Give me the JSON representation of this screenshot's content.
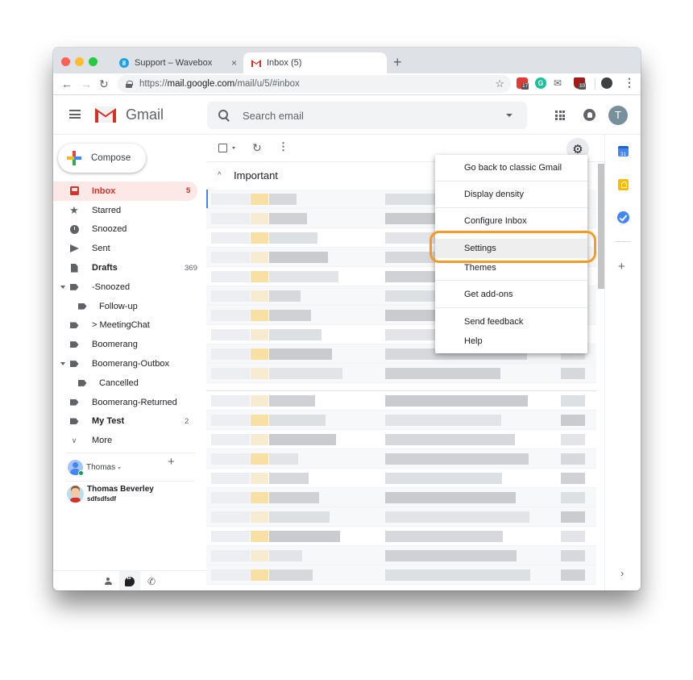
{
  "browser": {
    "tabs": [
      {
        "title": "Support – Wavebox",
        "favicon": "wavebox-icon",
        "active": false
      },
      {
        "title": "Inbox (5)",
        "favicon": "gmail-icon",
        "active": true
      }
    ],
    "new_tab_label": "+",
    "close_tab_glyph": "×",
    "url_scheme": "https://",
    "url_host": "mail.google.com",
    "url_path": "/mail/u/5/#inbox",
    "extensions": [
      {
        "name": "calendar-extension",
        "badge": "17"
      },
      {
        "name": "grammarly-extension",
        "badge": ""
      },
      {
        "name": "mail-checker-extension",
        "badge": ""
      },
      {
        "name": "ublock-extension",
        "badge": "10"
      },
      {
        "name": "profile-extension",
        "badge": ""
      }
    ]
  },
  "header": {
    "app_name": "Gmail",
    "search_placeholder": "Search email",
    "avatar_letter": "T"
  },
  "compose_label": "Compose",
  "sidebar": {
    "items": [
      {
        "label": "Inbox",
        "icon": "inbox-icon",
        "count": "5",
        "active": true,
        "bold": true,
        "level": 0
      },
      {
        "label": "Starred",
        "icon": "star-icon",
        "count": "",
        "level": 0
      },
      {
        "label": "Snoozed",
        "icon": "clock-icon",
        "count": "",
        "level": 0
      },
      {
        "label": "Sent",
        "icon": "send-icon",
        "count": "",
        "level": 0
      },
      {
        "label": "Drafts",
        "icon": "draft-icon",
        "count": "369",
        "bold": true,
        "level": 0
      },
      {
        "label": "-Snoozed",
        "icon": "label-icon",
        "count": "",
        "level": 0,
        "expanded": true
      },
      {
        "label": "Follow-up",
        "icon": "label-icon",
        "count": "",
        "level": 1
      },
      {
        "label": "> MeetingChat",
        "icon": "label-icon",
        "count": "",
        "level": 0
      },
      {
        "label": "Boomerang",
        "icon": "label-icon",
        "count": "",
        "level": 0
      },
      {
        "label": "Boomerang-Outbox",
        "icon": "label-icon",
        "count": "",
        "level": 0,
        "expanded": true
      },
      {
        "label": "Cancelled",
        "icon": "label-icon",
        "count": "",
        "level": 1
      },
      {
        "label": "Boomerang-Returned",
        "icon": "label-icon",
        "count": "",
        "level": 0
      },
      {
        "label": "My Test",
        "icon": "label-icon",
        "count": "2",
        "bold": true,
        "level": 0
      },
      {
        "label": "More",
        "icon": "chevron-down-icon",
        "count": "",
        "level": 0
      }
    ]
  },
  "hangouts": {
    "user_name": "Thomas",
    "add_glyph": "+",
    "contacts": [
      {
        "name": "Thomas Beverley",
        "status": "sdfsdfsdf"
      }
    ]
  },
  "main": {
    "section_title": "Important",
    "section_chevron": "^"
  },
  "settings_menu": {
    "items": [
      {
        "label": "Go back to classic Gmail"
      },
      {
        "label": "Display density"
      },
      {
        "label": "Configure Inbox"
      },
      {
        "label": "Settings",
        "highlighted": true
      },
      {
        "label": "Themes"
      },
      {
        "label": "Get add-ons"
      },
      {
        "label": "Send feedback"
      },
      {
        "label": "Help"
      }
    ]
  },
  "side_panel": {
    "calendar_day": "31",
    "add_glyph": "+",
    "expand_glyph": "›"
  },
  "colors": {
    "accent_red": "#d93025",
    "inbox_active_bg": "#fce8e6",
    "highlight_ring": "#f59a23",
    "important_marker": "#f7df9c"
  }
}
